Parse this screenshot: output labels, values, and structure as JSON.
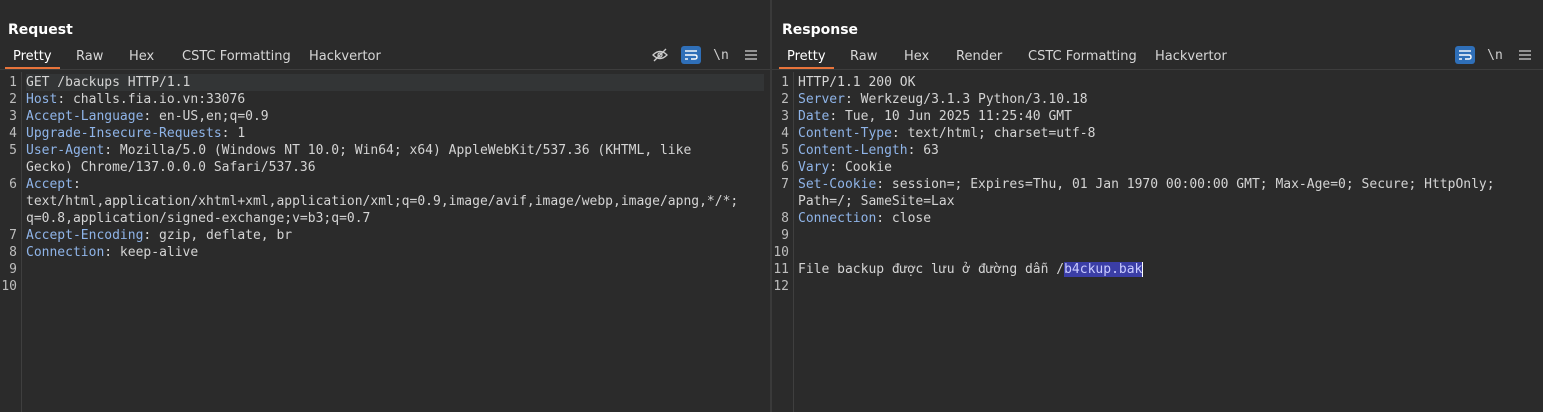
{
  "request": {
    "title": "Request",
    "tabs": [
      "Pretty",
      "Raw",
      "Hex",
      "CSTC Formatting",
      "Hackvertor"
    ],
    "newline_label": "\\n",
    "lines": [
      {
        "n": "1",
        "k": "",
        "v": "GET /backups HTTP/1.1"
      },
      {
        "n": "2",
        "k": "Host",
        "v": " challs.fia.io.vn:33076"
      },
      {
        "n": "3",
        "k": "Accept-Language",
        "v": " en-US,en;q=0.9"
      },
      {
        "n": "4",
        "k": "Upgrade-Insecure-Requests",
        "v": " 1"
      },
      {
        "n": "5",
        "k": "User-Agent",
        "v": " Mozilla/5.0 (Windows NT 10.0; Win64; x64) AppleWebKit/537.36 (KHTML, like"
      },
      {
        "n": "",
        "k": "",
        "v": "Gecko) Chrome/137.0.0.0 Safari/537.36"
      },
      {
        "n": "6",
        "k": "Accept",
        "v": ""
      },
      {
        "n": "",
        "k": "",
        "v": "text/html,application/xhtml+xml,application/xml;q=0.9,image/avif,image/webp,image/apng,*/*;"
      },
      {
        "n": "",
        "k": "",
        "v": "q=0.8,application/signed-exchange;v=b3;q=0.7"
      },
      {
        "n": "7",
        "k": "Accept-Encoding",
        "v": " gzip, deflate, br"
      },
      {
        "n": "8",
        "k": "Connection",
        "v": " keep-alive"
      },
      {
        "n": "9",
        "k": "",
        "v": ""
      },
      {
        "n": "10",
        "k": "",
        "v": ""
      }
    ]
  },
  "response": {
    "title": "Response",
    "tabs": [
      "Pretty",
      "Raw",
      "Hex",
      "Render",
      "CSTC Formatting",
      "Hackvertor"
    ],
    "newline_label": "\\n",
    "lines": [
      {
        "n": "1",
        "k": "",
        "v": "HTTP/1.1 200 OK"
      },
      {
        "n": "2",
        "k": "Server",
        "v": " Werkzeug/3.1.3 Python/3.10.18"
      },
      {
        "n": "3",
        "k": "Date",
        "v": " Tue, 10 Jun 2025 11:25:40 GMT"
      },
      {
        "n": "4",
        "k": "Content-Type",
        "v": " text/html; charset=utf-8"
      },
      {
        "n": "5",
        "k": "Content-Length",
        "v": " 63"
      },
      {
        "n": "6",
        "k": "Vary",
        "v": " Cookie"
      },
      {
        "n": "7",
        "k": "Set-Cookie",
        "v": " session=; Expires=Thu, 01 Jan 1970 00:00:00 GMT; Max-Age=0; Secure; HttpOnly;"
      },
      {
        "n": "",
        "k": "",
        "v": "Path=/; SameSite=Lax"
      },
      {
        "n": "8",
        "k": "Connection",
        "v": " close"
      },
      {
        "n": "9",
        "k": "",
        "v": ""
      },
      {
        "n": "10",
        "k": "",
        "v": ""
      },
      {
        "n": "11",
        "k": "",
        "v": "File backup được lưu ở đường dẫn /",
        "sel": "b4ckup.bak"
      },
      {
        "n": "12",
        "k": "",
        "v": ""
      }
    ]
  },
  "colors": {
    "accent": "#e8743b",
    "selected_button": "#2f6fb8",
    "header_key": "#8fb4e8"
  },
  "icons": {
    "view_layout": [
      "split-columns-icon",
      "split-rows-icon",
      "single-pane-icon"
    ],
    "request_tools": [
      "eye-off-icon",
      "wrap-icon",
      "newline-icon",
      "menu-icon"
    ],
    "response_tools": [
      "wrap-icon",
      "newline-icon",
      "menu-icon"
    ]
  }
}
